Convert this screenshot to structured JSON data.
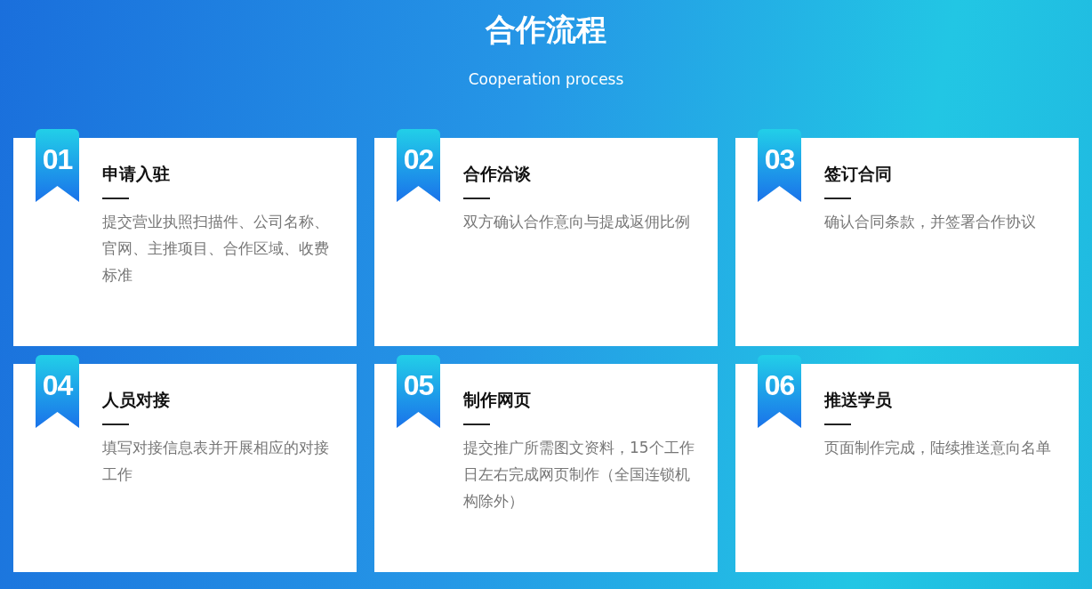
{
  "header": {
    "title": "合作流程",
    "subtitle": "Cooperation process"
  },
  "steps": [
    {
      "number": "01",
      "title": "申请入驻",
      "description": "提交营业执照扫描件、公司名称、官网、主推项目、合作区域、收费标准"
    },
    {
      "number": "02",
      "title": "合作洽谈",
      "description": "双方确认合作意向与提成返佣比例"
    },
    {
      "number": "03",
      "title": "签订合同",
      "description": "确认合同条款，并签署合作协议"
    },
    {
      "number": "04",
      "title": "人员对接",
      "description": "填写对接信息表并开展相应的对接工作"
    },
    {
      "number": "05",
      "title": "制作网页",
      "description": "提交推广所需图文资料，15个工作日左右完成网页制作（全国连锁机构除外）"
    },
    {
      "number": "06",
      "title": "推送学员",
      "description": "页面制作完成，陆续推送意向名单"
    }
  ]
}
